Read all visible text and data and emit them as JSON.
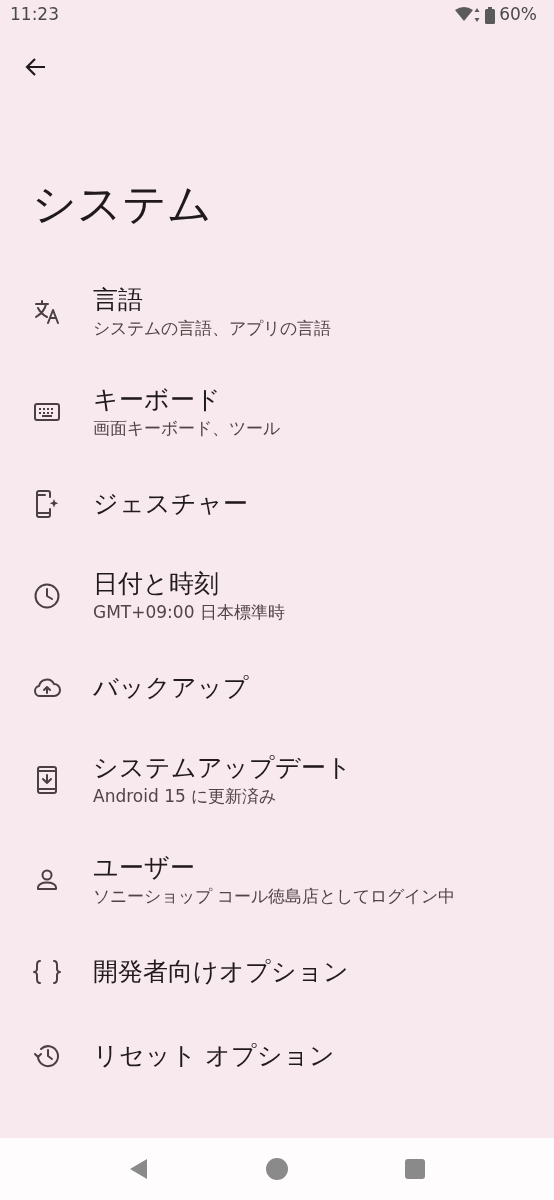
{
  "status_bar": {
    "time": "11:23",
    "battery": "60%"
  },
  "title": "システム",
  "items": [
    {
      "kind": "language",
      "title": "言語",
      "subtitle": "システムの言語、アプリの言語"
    },
    {
      "kind": "keyboard",
      "title": "キーボード",
      "subtitle": "画面キーボード、ツール"
    },
    {
      "kind": "gesture",
      "title": "ジェスチャー"
    },
    {
      "kind": "clock",
      "title": "日付と時刻",
      "subtitle": "GMT+09:00 日本標準時"
    },
    {
      "kind": "backup",
      "title": "バックアップ"
    },
    {
      "kind": "update",
      "title": "システムアップデート",
      "subtitle": "Android 15 に更新済み"
    },
    {
      "kind": "user",
      "title": "ユーザー",
      "subtitle": "ソニーショップ コール徳島店としてログイン中"
    },
    {
      "kind": "developer",
      "title": "開発者向けオプション"
    },
    {
      "kind": "reset",
      "title": "リセット オプション"
    }
  ]
}
